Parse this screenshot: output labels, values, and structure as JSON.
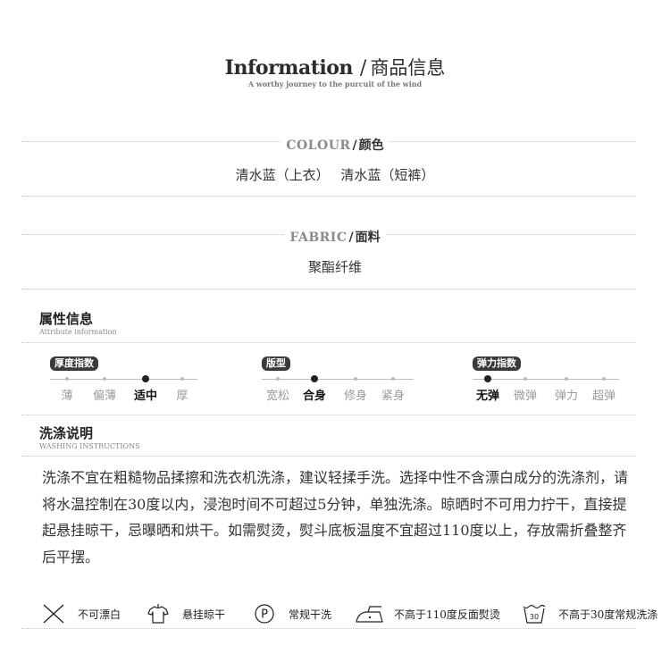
{
  "header": {
    "title_en": "Information",
    "title_sep": "/",
    "title_cn": "商品信息",
    "subtitle": "A worthy journey to the purcuit of the wind"
  },
  "colour": {
    "label_en": "COLOUR",
    "label_sep": "/",
    "label_cn": "颜色",
    "values": [
      "清水蓝（上衣）",
      "清水蓝（短裤）"
    ]
  },
  "fabric": {
    "label_en": "FABRIC",
    "label_sep": "/",
    "label_cn": "面料",
    "value": "聚酯纤维"
  },
  "attributes": {
    "title": "属性信息",
    "subtitle": "Attribute information",
    "scales": [
      {
        "name": "厚度指数",
        "options": [
          "薄",
          "偏薄",
          "适中",
          "厚"
        ],
        "selected_index": 2
      },
      {
        "name": "版型",
        "options": [
          "宽松",
          "合身",
          "修身",
          "紧身"
        ],
        "selected_index": 1
      },
      {
        "name": "弹力指数",
        "options": [
          "无弹",
          "微弹",
          "弹力",
          "超弹"
        ],
        "selected_index": 0
      }
    ]
  },
  "washing": {
    "title": "洗涤说明",
    "subtitle": "WASHING INSTRUCTIONS",
    "text": "洗涤不宜在粗糙物品揉擦和洗衣机洗涤，建议轻揉手洗。选择中性不含漂白成分的洗涤剂，请将水温控制在30度以内，浸泡时间不可超过5分钟，单独洗涤。晾晒时不可用力拧干，直接提起悬挂晾干，忌曝晒和烘干。如需熨烫，熨斗底板温度不宜超过110度以上，存放需折叠整齐后平摆。",
    "care_icons": [
      {
        "icon": "no-bleach-icon",
        "label": "不可漂白"
      },
      {
        "icon": "hang-dry-icon",
        "label": "悬挂晾干"
      },
      {
        "icon": "dry-clean-p-icon",
        "label": "常规干洗",
        "glyph": "P"
      },
      {
        "icon": "iron-icon",
        "label": "不高于110度反面熨烫"
      },
      {
        "icon": "wash-30-icon",
        "label": "不高于30度常规洗涤",
        "glyph": "30"
      }
    ]
  }
}
